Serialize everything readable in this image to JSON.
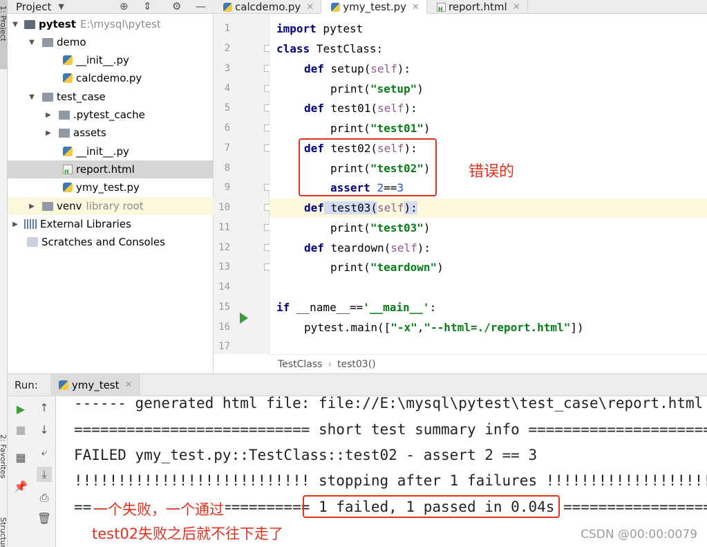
{
  "side_strip": {
    "top_label": "1: Project",
    "bottom_label_1": "2: Favorites",
    "bottom_label_2": "Structure"
  },
  "project": {
    "title": "Project",
    "tree": [
      {
        "label": "pytest",
        "extra": "E:\\mysql\\pytest"
      },
      {
        "label": "demo"
      },
      {
        "label": "__init__.py"
      },
      {
        "label": "calcdemo.py"
      },
      {
        "label": "test_case"
      },
      {
        "label": ".pytest_cache"
      },
      {
        "label": "assets"
      },
      {
        "label": "__init__.py"
      },
      {
        "label": "report.html"
      },
      {
        "label": "ymy_test.py"
      },
      {
        "label": "venv",
        "extra": "library root"
      },
      {
        "label": "External Libraries"
      },
      {
        "label": "Scratches and Consoles"
      }
    ]
  },
  "tabs": [
    {
      "label": "calcdemo.py"
    },
    {
      "label": "ymy_test.py"
    },
    {
      "label": "report.html"
    }
  ],
  "line_numbers": [
    "1",
    "2",
    "3",
    "4",
    "5",
    "6",
    "7",
    "8",
    "9",
    "10",
    "11",
    "12",
    "13",
    "14",
    "15",
    "16",
    "17"
  ],
  "code": {
    "l1": {
      "kw": "import",
      "rest": " pytest"
    },
    "l2": {
      "kw": "class",
      "rest": " TestClass:"
    },
    "l3": {
      "kw": "def",
      "name": " setup",
      "p1": "(",
      "self": "self",
      "p2": "):"
    },
    "l4": {
      "fn": "print",
      "p1": "(",
      "str": "\"setup\"",
      "p2": ")"
    },
    "l5": {
      "kw": "def",
      "name": " test01",
      "p1": "(",
      "self": "self",
      "p2": "):"
    },
    "l6": {
      "fn": "print",
      "p1": "(",
      "str": "\"test01\"",
      "p2": ")"
    },
    "l7": {
      "kw": "def",
      "name": " test02",
      "p1": "(",
      "self": "self",
      "p2": "):"
    },
    "l8": {
      "fn": "print",
      "p1": "(",
      "str": "\"test02\"",
      "p2": ")"
    },
    "l9": {
      "kw": "assert",
      "num1": " 2",
      "op": "==",
      "num2": "3"
    },
    "l10": {
      "kw": "def",
      "name": " test03",
      "p1": "(",
      "self": "self",
      "p2": "):"
    },
    "l11": {
      "fn": "print",
      "p1": "(",
      "str": "\"test03\"",
      "p2": ")"
    },
    "l12": {
      "kw": "def",
      "name": " teardown",
      "p1": "(",
      "self": "self",
      "p2": "):"
    },
    "l13": {
      "fn": "print",
      "p1": "(",
      "str": "\"teardown\"",
      "p2": ")"
    },
    "l15": {
      "kw": "if",
      "rest": " __name__==",
      "str": "'__main__'",
      "end": ":"
    },
    "l16": {
      "pre": "pytest.main([",
      "s1": "\"-x\"",
      "comma": ",",
      "s2": "\"--html=./report.html\"",
      "end": "])"
    }
  },
  "breadcrumb": {
    "first": "TestClass",
    "sep": "›",
    "second": "test03()"
  },
  "run": {
    "label": "Run:",
    "tab": "ymy_test",
    "console": [
      "------ generated html file: file://E:\\mysql\\pytest\\test_case\\report.html ------",
      "=========================== short test summary info ===========================",
      "FAILED ymy_test.py::TestClass::test02 - assert 2 == 3",
      "!!!!!!!!!!!!!!!!!!!!!!!!!!! stopping after 1 failures !!!!!!!!!!!!!!!!!!!!!!!!!!!",
      "=========================== 1 failed, 1 passed in 0.04s ==========================="
    ]
  },
  "annotations": {
    "error_label": "错误的",
    "summary_line1": "一个失败，一个通过",
    "summary_line2": "test02失败之后就不往下走了",
    "color": "#e0301e"
  },
  "watermark": "CSDN @00:00:0079"
}
